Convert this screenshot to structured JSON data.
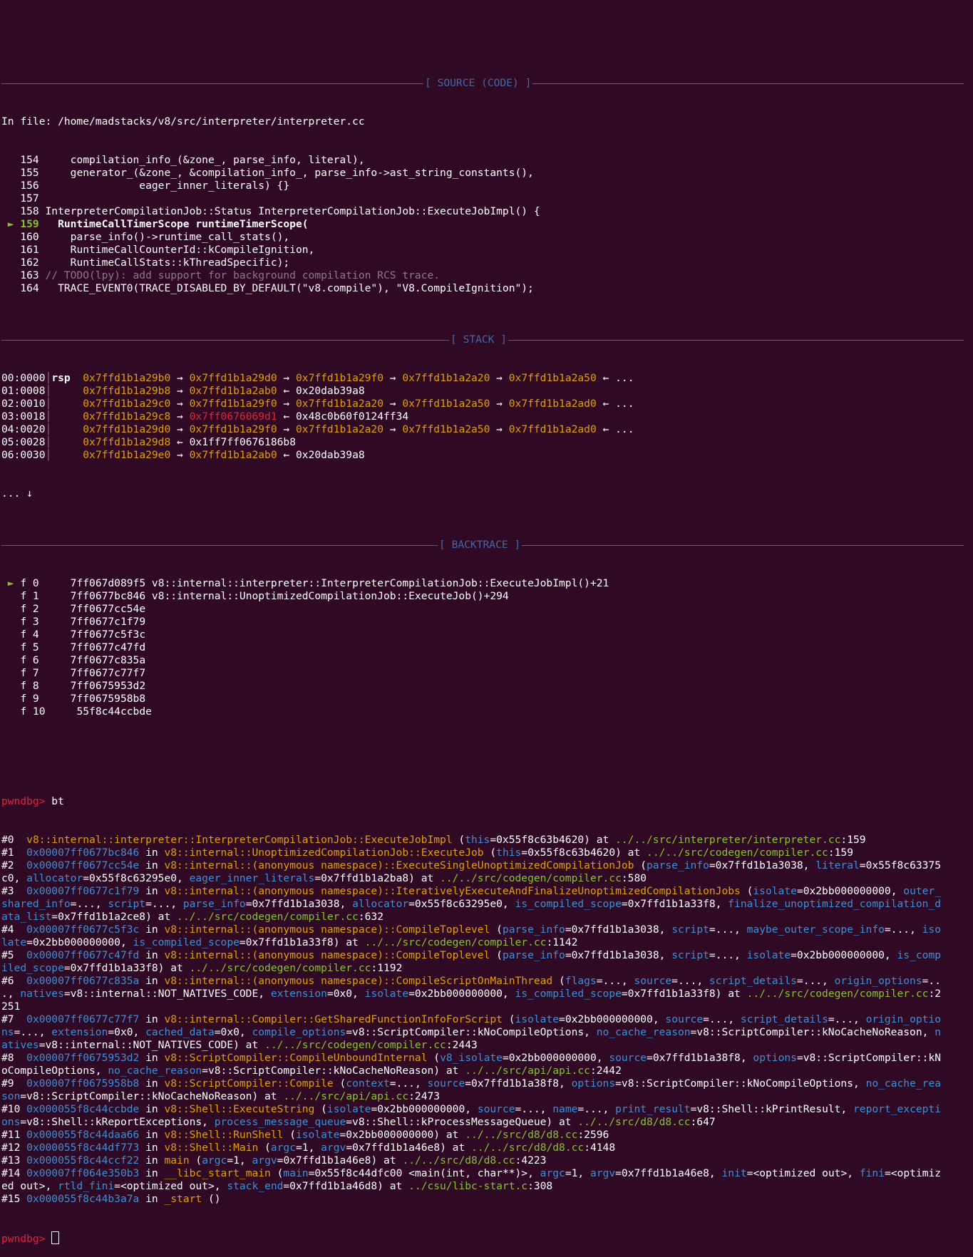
{
  "separators": {
    "source": "[ SOURCE (CODE) ]",
    "stack": "[ STACK ]",
    "backtrace": "[ BACKTRACE ]"
  },
  "source": {
    "file_prefix": "In file: ",
    "file_path": "/home/madstacks/v8/src/interpreter/interpreter.cc",
    "lines": [
      {
        "num": "154",
        "code": "    compilation_info_(&zone_, parse_info, literal),"
      },
      {
        "num": "155",
        "code": "    generator_(&zone_, &compilation_info_, parse_info->ast_string_constants(),"
      },
      {
        "num": "156",
        "code": "               eager_inner_literals) {}"
      },
      {
        "num": "157",
        "code": ""
      },
      {
        "num": "158",
        "code": "InterpreterCompilationJob::Status InterpreterCompilationJob::ExecuteJobImpl() {"
      },
      {
        "num": "159",
        "code": "  RuntimeCallTimerScope runtimeTimerScope(",
        "current": true
      },
      {
        "num": "160",
        "code": "    parse_info()->runtime_call_stats(),"
      },
      {
        "num": "161",
        "code": "    RuntimeCallCounterId::kCompileIgnition,"
      },
      {
        "num": "162",
        "code": "    RuntimeCallStats::kThreadSpecific);"
      },
      {
        "num": "163",
        "code": "// TODO(lpy): add support for background compilation RCS trace."
      },
      {
        "num": "164",
        "code": "  TRACE_EVENT0(TRACE_DISABLED_BY_DEFAULT(\"v8.compile\"), \"V8.CompileIgnition\");"
      }
    ],
    "current_marker": "►"
  },
  "stack": {
    "rows": [
      {
        "off": "00:0000",
        "reg": "rsp",
        "chain": [
          "0x7ffd1b1a29b0",
          "0x7ffd1b1a29d0",
          "0x7ffd1b1a29f0",
          "0x7ffd1b1a2a20",
          "0x7ffd1b1a2a50"
        ],
        "tail": "..."
      },
      {
        "off": "01:0008",
        "reg": "",
        "chain": [
          "0x7ffd1b1a29b8",
          "0x7ffd1b1a2ab0"
        ],
        "tail": "0x20dab39a8"
      },
      {
        "off": "02:0010",
        "reg": "",
        "chain": [
          "0x7ffd1b1a29c0",
          "0x7ffd1b1a29f0",
          "0x7ffd1b1a2a20",
          "0x7ffd1b1a2a50",
          "0x7ffd1b1a2ad0"
        ],
        "tail": "..."
      },
      {
        "off": "03:0018",
        "reg": "",
        "chain": [
          "0x7ffd1b1a29c8",
          "0x7ff0676069d1"
        ],
        "tail": "0x48c0b60f0124ff34",
        "code_idx": 1
      },
      {
        "off": "04:0020",
        "reg": "",
        "chain": [
          "0x7ffd1b1a29d0",
          "0x7ffd1b1a29f0",
          "0x7ffd1b1a2a20",
          "0x7ffd1b1a2a50",
          "0x7ffd1b1a2ad0"
        ],
        "tail": "..."
      },
      {
        "off": "05:0028",
        "reg": "",
        "chain": [
          "0x7ffd1b1a29d8"
        ],
        "tail": "0x1ff7ff0676186b8"
      },
      {
        "off": "06:0030",
        "reg": "",
        "chain": [
          "0x7ffd1b1a29e0",
          "0x7ffd1b1a2ab0"
        ],
        "tail": "0x20dab39a8"
      }
    ],
    "more": "... ↓",
    "arrow": "→",
    "back_arrow": "←"
  },
  "backtrace": {
    "frames": [
      {
        "label": "f 0",
        "addr": "7ff067d089f5",
        "sym": "v8::internal::interpreter::InterpreterCompilationJob::ExecuteJobImpl()+21",
        "current": true
      },
      {
        "label": "f 1",
        "addr": "7ff0677bc846",
        "sym": "v8::internal::UnoptimizedCompilationJob::ExecuteJob()+294"
      },
      {
        "label": "f 2",
        "addr": "7ff0677cc54e",
        "sym": ""
      },
      {
        "label": "f 3",
        "addr": "7ff0677c1f79",
        "sym": ""
      },
      {
        "label": "f 4",
        "addr": "7ff0677c5f3c",
        "sym": ""
      },
      {
        "label": "f 5",
        "addr": "7ff0677c47fd",
        "sym": ""
      },
      {
        "label": "f 6",
        "addr": "7ff0677c835a",
        "sym": ""
      },
      {
        "label": "f 7",
        "addr": "7ff0677c77f7",
        "sym": ""
      },
      {
        "label": "f 8",
        "addr": "7ff0675953d2",
        "sym": ""
      },
      {
        "label": "f 9",
        "addr": "7ff0675958b8",
        "sym": ""
      },
      {
        "label": "f 10",
        "addr": " 55f8c44ccbde",
        "sym": ""
      }
    ]
  },
  "prompt": "pwndbg>",
  "command": " bt",
  "bt_lines": [
    [
      [
        "#0  ",
        "w"
      ],
      [
        "v8::internal::interpreter::InterpreterCompilationJob::ExecuteJobImpl",
        "y"
      ],
      [
        " (",
        "w"
      ],
      [
        "this",
        "b"
      ],
      [
        "=0x55f8c63b4620) at ",
        "w"
      ],
      [
        "../../src/interpreter/interpreter.cc",
        "g"
      ],
      [
        ":159",
        "w"
      ]
    ],
    [
      [
        "#1  ",
        "w"
      ],
      [
        "0x00007ff0677bc846",
        "b"
      ],
      [
        " in ",
        "w"
      ],
      [
        "v8::internal::UnoptimizedCompilationJob::ExecuteJob",
        "y"
      ],
      [
        " (",
        "w"
      ],
      [
        "this",
        "b"
      ],
      [
        "=0x55f8c63b4620) at ",
        "w"
      ],
      [
        "../../src/codegen/compiler.cc",
        "g"
      ],
      [
        ":159",
        "w"
      ]
    ],
    [
      [
        "#2  ",
        "w"
      ],
      [
        "0x00007ff0677cc54e",
        "b"
      ],
      [
        " in ",
        "w"
      ],
      [
        "v8::internal::(anonymous namespace)::ExecuteSingleUnoptimizedCompilationJob",
        "y"
      ],
      [
        " (",
        "w"
      ],
      [
        "parse_info",
        "b"
      ],
      [
        "=0x7ffd1b1a3038, ",
        "w"
      ],
      [
        "literal",
        "b"
      ],
      [
        "=0x55f8c63375",
        "w"
      ]
    ],
    [
      [
        "c0, ",
        "w"
      ],
      [
        "allocator",
        "b"
      ],
      [
        "=0x55f8c63295e0, ",
        "w"
      ],
      [
        "eager_inner_literals",
        "b"
      ],
      [
        "=0x7ffd1b1a2ba8) at ",
        "w"
      ],
      [
        "../../src/codegen/compiler.cc",
        "g"
      ],
      [
        ":580",
        "w"
      ]
    ],
    [
      [
        "#3  ",
        "w"
      ],
      [
        "0x00007ff0677c1f79",
        "b"
      ],
      [
        " in ",
        "w"
      ],
      [
        "v8::internal::(anonymous namespace)::IterativelyExecuteAndFinalizeUnoptimizedCompilationJobs",
        "y"
      ],
      [
        " (",
        "w"
      ],
      [
        "isolate",
        "b"
      ],
      [
        "=0x2bb000000000, ",
        "w"
      ],
      [
        "outer_",
        "b"
      ]
    ],
    [
      [
        "shared_info",
        "b"
      ],
      [
        "=..., ",
        "w"
      ],
      [
        "script",
        "b"
      ],
      [
        "=..., ",
        "w"
      ],
      [
        "parse_info",
        "b"
      ],
      [
        "=0x7ffd1b1a3038, ",
        "w"
      ],
      [
        "allocator",
        "b"
      ],
      [
        "=0x55f8c63295e0, ",
        "w"
      ],
      [
        "is_compiled_scope",
        "b"
      ],
      [
        "=0x7ffd1b1a33f8, ",
        "w"
      ],
      [
        "finalize_unoptimized_compilation_d",
        "b"
      ]
    ],
    [
      [
        "ata_list",
        "b"
      ],
      [
        "=0x7ffd1b1a2ce8) at ",
        "w"
      ],
      [
        "../../src/codegen/compiler.cc",
        "g"
      ],
      [
        ":632",
        "w"
      ]
    ],
    [
      [
        "#4  ",
        "w"
      ],
      [
        "0x00007ff0677c5f3c",
        "b"
      ],
      [
        " in ",
        "w"
      ],
      [
        "v8::internal::(anonymous namespace)::CompileToplevel",
        "y"
      ],
      [
        " (",
        "w"
      ],
      [
        "parse_info",
        "b"
      ],
      [
        "=0x7ffd1b1a3038, ",
        "w"
      ],
      [
        "script",
        "b"
      ],
      [
        "=..., ",
        "w"
      ],
      [
        "maybe_outer_scope_info",
        "b"
      ],
      [
        "=..., ",
        "w"
      ],
      [
        "iso",
        "b"
      ]
    ],
    [
      [
        "late",
        "b"
      ],
      [
        "=0x2bb000000000, ",
        "w"
      ],
      [
        "is_compiled_scope",
        "b"
      ],
      [
        "=0x7ffd1b1a33f8) at ",
        "w"
      ],
      [
        "../../src/codegen/compiler.cc",
        "g"
      ],
      [
        ":1142",
        "w"
      ]
    ],
    [
      [
        "#5  ",
        "w"
      ],
      [
        "0x00007ff0677c47fd",
        "b"
      ],
      [
        " in ",
        "w"
      ],
      [
        "v8::internal::(anonymous namespace)::CompileToplevel",
        "y"
      ],
      [
        " (",
        "w"
      ],
      [
        "parse_info",
        "b"
      ],
      [
        "=0x7ffd1b1a3038, ",
        "w"
      ],
      [
        "script",
        "b"
      ],
      [
        "=..., ",
        "w"
      ],
      [
        "isolate",
        "b"
      ],
      [
        "=0x2bb000000000, ",
        "w"
      ],
      [
        "is_comp",
        "b"
      ]
    ],
    [
      [
        "iled_scope",
        "b"
      ],
      [
        "=0x7ffd1b1a33f8) at ",
        "w"
      ],
      [
        "../../src/codegen/compiler.cc",
        "g"
      ],
      [
        ":1192",
        "w"
      ]
    ],
    [
      [
        "#6  ",
        "w"
      ],
      [
        "0x00007ff0677c835a",
        "b"
      ],
      [
        " in ",
        "w"
      ],
      [
        "v8::internal::(anonymous namespace)::CompileScriptOnMainThread",
        "y"
      ],
      [
        " (",
        "w"
      ],
      [
        "flags",
        "b"
      ],
      [
        "=..., ",
        "w"
      ],
      [
        "source",
        "b"
      ],
      [
        "=..., ",
        "w"
      ],
      [
        "script_details",
        "b"
      ],
      [
        "=..., ",
        "w"
      ],
      [
        "origin_options",
        "b"
      ],
      [
        "=..",
        "w"
      ]
    ],
    [
      [
        "., ",
        "w"
      ],
      [
        "natives",
        "b"
      ],
      [
        "=v8::internal::NOT_NATIVES_CODE, ",
        "w"
      ],
      [
        "extension",
        "b"
      ],
      [
        "=0x0, ",
        "w"
      ],
      [
        "isolate",
        "b"
      ],
      [
        "=0x2bb000000000, ",
        "w"
      ],
      [
        "is_compiled_scope",
        "b"
      ],
      [
        "=0x7ffd1b1a33f8) at ",
        "w"
      ],
      [
        "../../src/codegen/compiler.cc",
        "g"
      ],
      [
        ":2",
        "w"
      ]
    ],
    [
      [
        "251",
        "w"
      ]
    ],
    [
      [
        "#7  ",
        "w"
      ],
      [
        "0x00007ff0677c77f7",
        "b"
      ],
      [
        " in ",
        "w"
      ],
      [
        "v8::internal::Compiler::GetSharedFunctionInfoForScript",
        "y"
      ],
      [
        " (",
        "w"
      ],
      [
        "isolate",
        "b"
      ],
      [
        "=0x2bb000000000, ",
        "w"
      ],
      [
        "source",
        "b"
      ],
      [
        "=..., ",
        "w"
      ],
      [
        "script_details",
        "b"
      ],
      [
        "=..., ",
        "w"
      ],
      [
        "origin_optio",
        "b"
      ]
    ],
    [
      [
        "ns",
        "b"
      ],
      [
        "=..., ",
        "w"
      ],
      [
        "extension",
        "b"
      ],
      [
        "=0x0, ",
        "w"
      ],
      [
        "cached_data",
        "b"
      ],
      [
        "=0x0, ",
        "w"
      ],
      [
        "compile_options",
        "b"
      ],
      [
        "=v8::ScriptCompiler::kNoCompileOptions, ",
        "w"
      ],
      [
        "no_cache_reason",
        "b"
      ],
      [
        "=v8::ScriptCompiler::kNoCacheNoReason, ",
        "w"
      ],
      [
        "n",
        "b"
      ]
    ],
    [
      [
        "atives",
        "b"
      ],
      [
        "=v8::internal::NOT_NATIVES_CODE) at ",
        "w"
      ],
      [
        "../../src/codegen/compiler.cc",
        "g"
      ],
      [
        ":2443",
        "w"
      ]
    ],
    [
      [
        "#8  ",
        "w"
      ],
      [
        "0x00007ff0675953d2",
        "b"
      ],
      [
        " in ",
        "w"
      ],
      [
        "v8::ScriptCompiler::CompileUnboundInternal",
        "y"
      ],
      [
        " (",
        "w"
      ],
      [
        "v8_isolate",
        "b"
      ],
      [
        "=0x2bb000000000, ",
        "w"
      ],
      [
        "source",
        "b"
      ],
      [
        "=0x7ffd1b1a38f8, ",
        "w"
      ],
      [
        "options",
        "b"
      ],
      [
        "=v8::ScriptCompiler::kN",
        "w"
      ]
    ],
    [
      [
        "oCompileOptions, ",
        "w"
      ],
      [
        "no_cache_reason",
        "b"
      ],
      [
        "=v8::ScriptCompiler::kNoCacheNoReason) at ",
        "w"
      ],
      [
        "../../src/api/api.cc",
        "g"
      ],
      [
        ":2442",
        "w"
      ]
    ],
    [
      [
        "#9  ",
        "w"
      ],
      [
        "0x00007ff0675958b8",
        "b"
      ],
      [
        " in ",
        "w"
      ],
      [
        "v8::ScriptCompiler::Compile",
        "y"
      ],
      [
        " (",
        "w"
      ],
      [
        "context",
        "b"
      ],
      [
        "=..., ",
        "w"
      ],
      [
        "source",
        "b"
      ],
      [
        "=0x7ffd1b1a38f8, ",
        "w"
      ],
      [
        "options",
        "b"
      ],
      [
        "=v8::ScriptCompiler::kNoCompileOptions, ",
        "w"
      ],
      [
        "no_cache_rea",
        "b"
      ]
    ],
    [
      [
        "son",
        "b"
      ],
      [
        "=v8::ScriptCompiler::kNoCacheNoReason) at ",
        "w"
      ],
      [
        "../../src/api/api.cc",
        "g"
      ],
      [
        ":2473",
        "w"
      ]
    ],
    [
      [
        "#10 ",
        "w"
      ],
      [
        "0x000055f8c44ccbde",
        "b"
      ],
      [
        " in ",
        "w"
      ],
      [
        "v8::Shell::ExecuteString",
        "y"
      ],
      [
        " (",
        "w"
      ],
      [
        "isolate",
        "b"
      ],
      [
        "=0x2bb000000000, ",
        "w"
      ],
      [
        "source",
        "b"
      ],
      [
        "=..., ",
        "w"
      ],
      [
        "name",
        "b"
      ],
      [
        "=..., ",
        "w"
      ],
      [
        "print_result",
        "b"
      ],
      [
        "=v8::Shell::kPrintResult, ",
        "w"
      ],
      [
        "report_excepti",
        "b"
      ]
    ],
    [
      [
        "ons",
        "b"
      ],
      [
        "=v8::Shell::kReportExceptions, ",
        "w"
      ],
      [
        "process_message_queue",
        "b"
      ],
      [
        "=v8::Shell::kProcessMessageQueue) at ",
        "w"
      ],
      [
        "../../src/d8/d8.cc",
        "g"
      ],
      [
        ":647",
        "w"
      ]
    ],
    [
      [
        "#11 ",
        "w"
      ],
      [
        "0x000055f8c44daa66",
        "b"
      ],
      [
        " in ",
        "w"
      ],
      [
        "v8::Shell::RunShell",
        "y"
      ],
      [
        " (",
        "w"
      ],
      [
        "isolate",
        "b"
      ],
      [
        "=0x2bb000000000) at ",
        "w"
      ],
      [
        "../../src/d8/d8.cc",
        "g"
      ],
      [
        ":2596",
        "w"
      ]
    ],
    [
      [
        "#12 ",
        "w"
      ],
      [
        "0x000055f8c44df773",
        "b"
      ],
      [
        " in ",
        "w"
      ],
      [
        "v8::Shell::Main",
        "y"
      ],
      [
        " (",
        "w"
      ],
      [
        "argc",
        "b"
      ],
      [
        "=1, ",
        "w"
      ],
      [
        "argv",
        "b"
      ],
      [
        "=0x7ffd1b1a46e8) at ",
        "w"
      ],
      [
        "../../src/d8/d8.cc",
        "g"
      ],
      [
        ":4148",
        "w"
      ]
    ],
    [
      [
        "#13 ",
        "w"
      ],
      [
        "0x000055f8c44ccf22",
        "b"
      ],
      [
        " in ",
        "w"
      ],
      [
        "main",
        "y"
      ],
      [
        " (",
        "w"
      ],
      [
        "argc",
        "b"
      ],
      [
        "=1, ",
        "w"
      ],
      [
        "argv",
        "b"
      ],
      [
        "=0x7ffd1b1a46e8) at ",
        "w"
      ],
      [
        "../../src/d8/d8.cc",
        "g"
      ],
      [
        ":4223",
        "w"
      ]
    ],
    [
      [
        "#14 ",
        "w"
      ],
      [
        "0x00007ff064e350b3",
        "b"
      ],
      [
        " in ",
        "w"
      ],
      [
        "__libc_start_main",
        "y"
      ],
      [
        " (",
        "w"
      ],
      [
        "main",
        "b"
      ],
      [
        "=0x55f8c44dfc00 <main(int, char**)>, ",
        "w"
      ],
      [
        "argc",
        "b"
      ],
      [
        "=1, ",
        "w"
      ],
      [
        "argv",
        "b"
      ],
      [
        "=0x7ffd1b1a46e8, ",
        "w"
      ],
      [
        "init",
        "b"
      ],
      [
        "=<optimized out>, ",
        "w"
      ],
      [
        "fini",
        "b"
      ],
      [
        "=<optimiz",
        "w"
      ]
    ],
    [
      [
        "ed out>, ",
        "w"
      ],
      [
        "rtld_fini",
        "b"
      ],
      [
        "=<optimized out>, ",
        "w"
      ],
      [
        "stack_end",
        "b"
      ],
      [
        "=0x7ffd1b1a46d8) at ",
        "w"
      ],
      [
        "../csu/libc-start.c",
        "g"
      ],
      [
        ":308",
        "w"
      ]
    ],
    [
      [
        "#15 ",
        "w"
      ],
      [
        "0x000055f8c44b3a7a",
        "b"
      ],
      [
        " in ",
        "w"
      ],
      [
        "_start",
        "y"
      ],
      [
        " ()",
        "w"
      ]
    ]
  ]
}
